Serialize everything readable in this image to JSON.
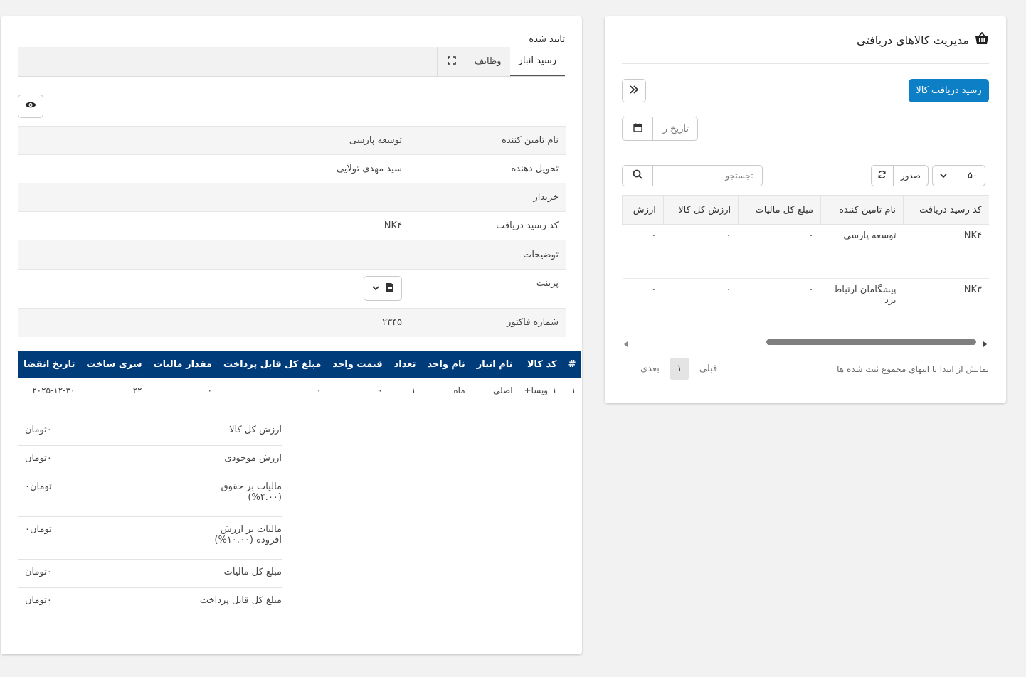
{
  "receipt_list": {
    "title": "مدیریت کالاهای دریافتی",
    "new_receipt_button": "رسید دریافت کالا",
    "date_placeholder": "تاریخ ر",
    "search_placeholder": "جستجو:",
    "export_button": "صدور",
    "page_length": "۵۰",
    "columns": [
      "کد رسید دریافت",
      "نام تامین کننده",
      "مبلغ کل مالیات",
      "ارزش کل کالا",
      "ارزش"
    ],
    "rows": [
      [
        "NK۴",
        "توسعه پارسی",
        "۰",
        "۰",
        "۰"
      ],
      [
        "NK۳",
        "پیشگامان ارتباط یزد",
        "۰",
        "۰",
        "۰"
      ]
    ],
    "info_text": "نمایش از ابتدا تا انتهاي مجموع ثبت شده ها",
    "pagination": {
      "prev": "قبلي",
      "current": "۱",
      "next": "بعدي"
    }
  },
  "receipt_detail": {
    "status": "تایید شده",
    "tabs": [
      "رسید انبار",
      "وظایف"
    ],
    "fields": [
      {
        "label": "نام تامین کننده",
        "value": "توسعه پارسی"
      },
      {
        "label": "تحویل دهنده",
        "value": "سید مهدی تولایی"
      },
      {
        "label": "خریدار",
        "value": ""
      },
      {
        "label": "کد رسید دریافت",
        "value": "NK۴"
      },
      {
        "label": "توضیحات",
        "value": ""
      },
      {
        "label": "پرینت",
        "value": ""
      },
      {
        "label": "شماره فاکتور",
        "value": "۲۳۴۵"
      }
    ],
    "items_columns": [
      "#",
      "کد کالا",
      "نام انبار",
      "نام واحد",
      "تعداد",
      "قیمت واحد",
      "مبلغ کل قابل پرداخت",
      "مقدار مالیات",
      "سری ساخت",
      "تاریخ انقضا"
    ],
    "items_rows": [
      [
        "۱",
        "۱_ویسا+",
        "اصلی",
        "ماه",
        "۱",
        "۰",
        "۰",
        "۰",
        "۲۲",
        "۲۰۲۵-۱۲-۳۰"
      ]
    ],
    "summary": [
      {
        "label": "ارزش کل کالا",
        "value": "۰تومان"
      },
      {
        "label": "ارزش موجودی",
        "value": "۰تومان"
      },
      {
        "label": "مالیات بر حقوق (۴.۰۰%)",
        "value": "تومان۰"
      },
      {
        "label": "مالیات بر ارزش افزوده (۱۰.۰۰%)",
        "value": "تومان۰"
      },
      {
        "label": "مبلغ کل مالیات",
        "value": "۰تومان"
      },
      {
        "label": "مبلغ کل قابل پرداخت",
        "value": "۰تومان"
      }
    ]
  }
}
